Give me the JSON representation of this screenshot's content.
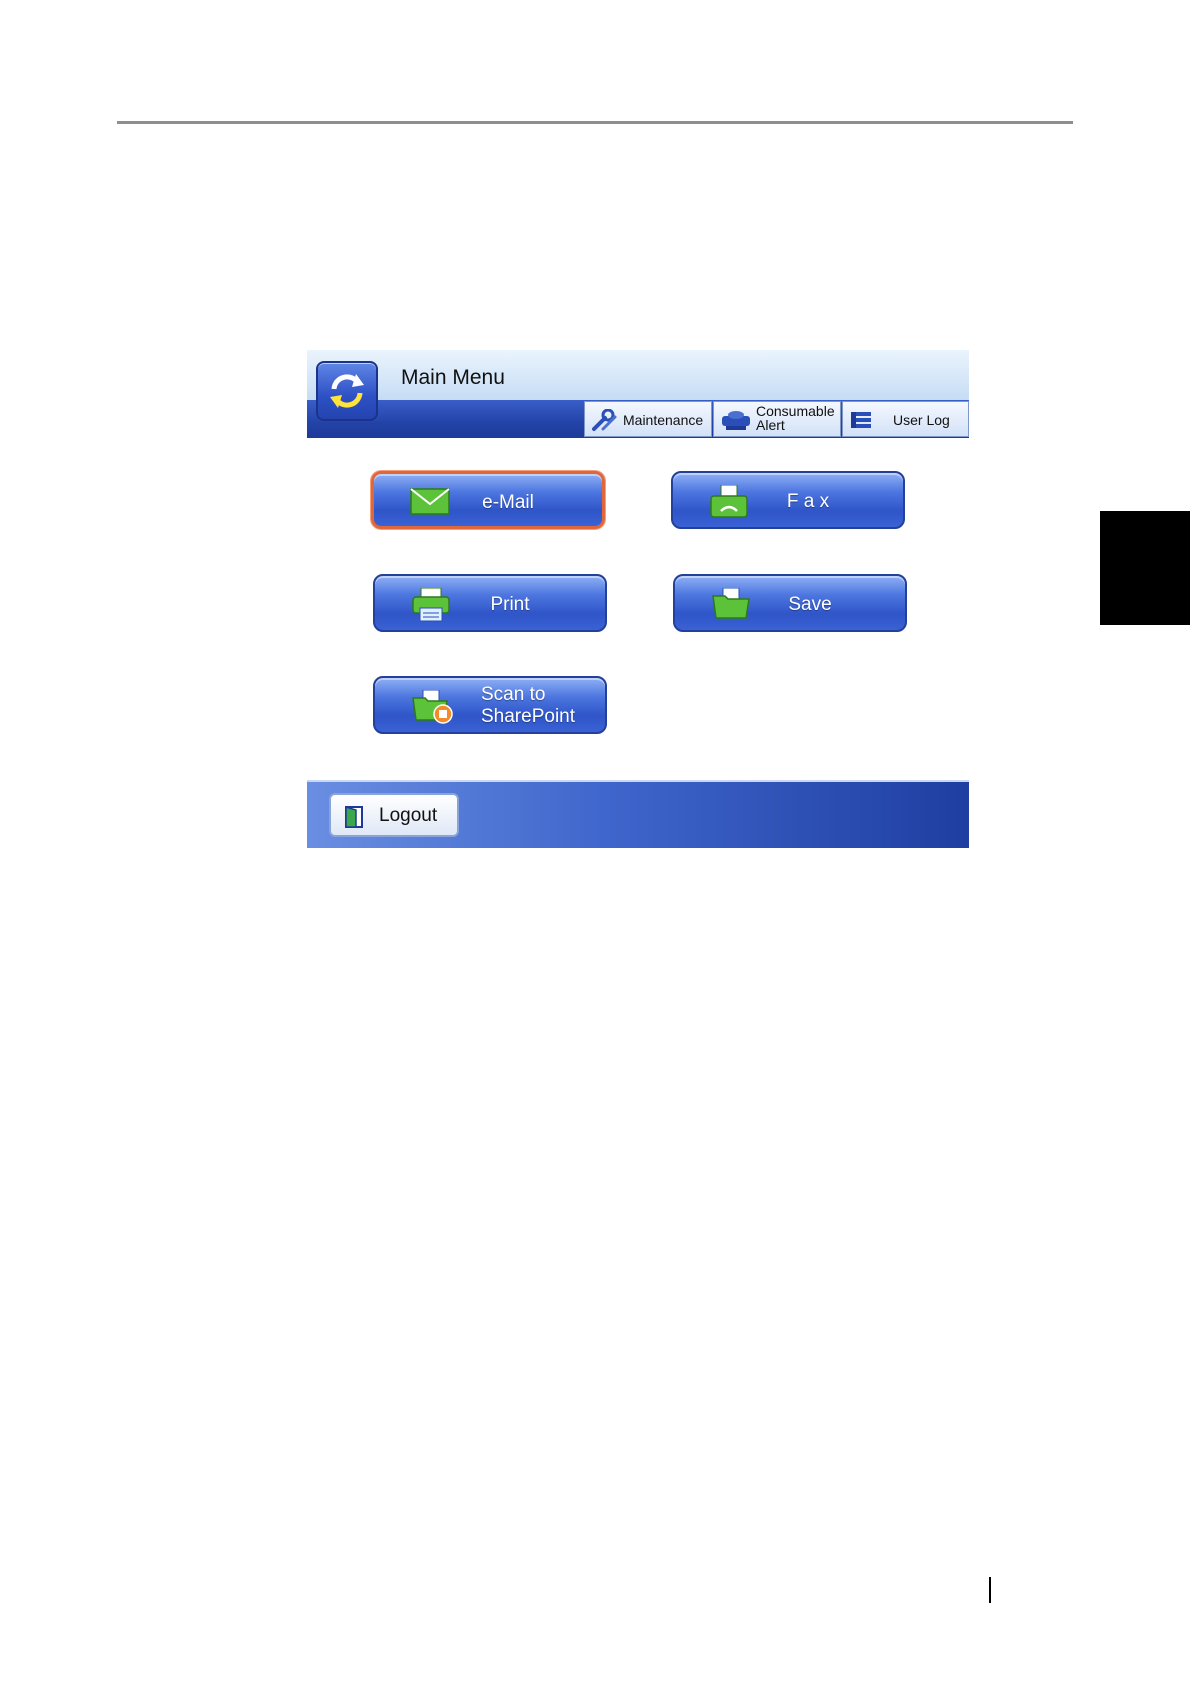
{
  "header": {
    "title": "Main Menu",
    "buttons": {
      "maintenance": "Maintenance",
      "consumable_alert_line1": "Consumable",
      "consumable_alert_line2": "Alert",
      "user_log": "User Log"
    }
  },
  "menu": {
    "email": "e-Mail",
    "fax": "F a x",
    "print": "Print",
    "save": "Save",
    "scan_sharepoint_line1": "Scan to",
    "scan_sharepoint_line2": "SharePoint"
  },
  "footer": {
    "logout": "Logout"
  },
  "colors": {
    "accent_blue": "#2f55c8",
    "selected_border": "#e0663b",
    "icon_green": "#5cc23a"
  }
}
